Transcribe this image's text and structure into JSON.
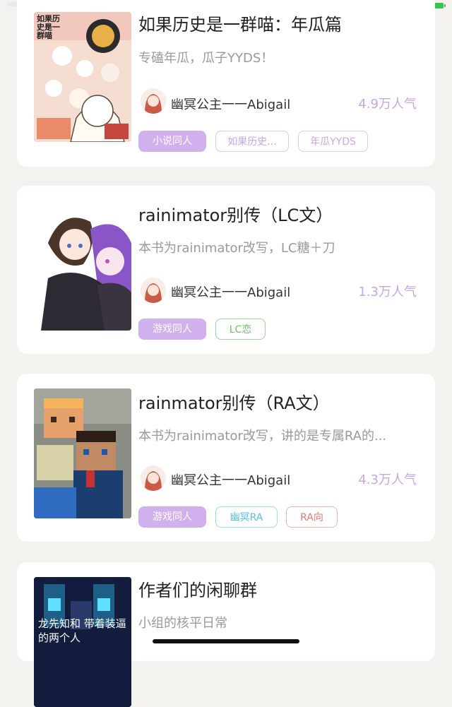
{
  "cards": [
    {
      "title": "如果历史是一群喵：年瓜篇",
      "description": "专磕年瓜，瓜子YYDS！",
      "author": "幽冥公主一一Abigail",
      "popularity": "4.9万人气",
      "tags": [
        "小说同人",
        "如果历史...",
        "年瓜YYDS"
      ],
      "cover_text": "如果历史是一群喵"
    },
    {
      "title": "rainimator别传（LC文）",
      "description": "本书为rainimator改写，LC糖＋刀",
      "author": "幽冥公主一一Abigail",
      "popularity": "1.3万人气",
      "tags": [
        "游戏同人",
        "LC恋"
      ]
    },
    {
      "title": "rainmator别传（RA文）",
      "description": "本书为rainimator改写，讲的是专属RA的...",
      "author": "幽冥公主一一Abigail",
      "popularity": "4.3万人气",
      "tags": [
        "游戏同人",
        "幽冥RA",
        "RA向"
      ]
    },
    {
      "title": "作者们的闲聊群",
      "description": "小组的核平日常",
      "cover_text": "龙先知和 带着装逼的两个人"
    }
  ],
  "colors": {
    "accent_purple": "#d1b0ee",
    "popularity": "#c7a6e6",
    "battery": "#3cc453"
  }
}
